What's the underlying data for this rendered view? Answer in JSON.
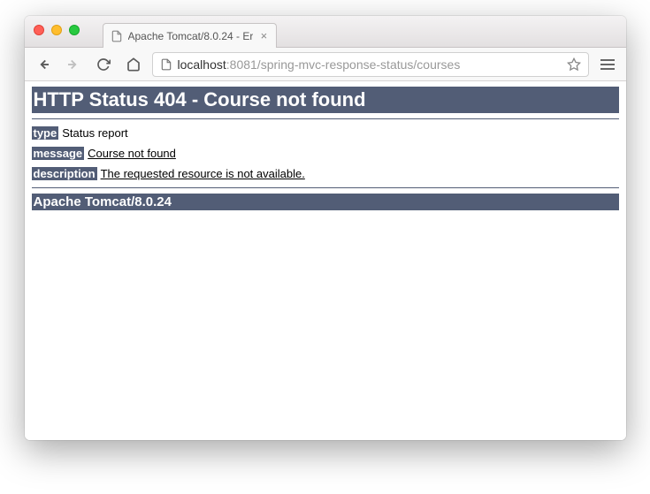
{
  "window": {
    "tab_title": "Apache Tomcat/8.0.24 - Er"
  },
  "address": {
    "host": "localhost",
    "port_path": ":8081/spring-mvc-response-status/courses"
  },
  "page": {
    "heading": "HTTP Status 404 - Course not found",
    "type_label": "type",
    "type_value": "Status report",
    "message_label": "message",
    "message_value": "Course not found",
    "description_label": "description",
    "description_value": "The requested resource is not available.",
    "footer": "Apache Tomcat/8.0.24"
  }
}
